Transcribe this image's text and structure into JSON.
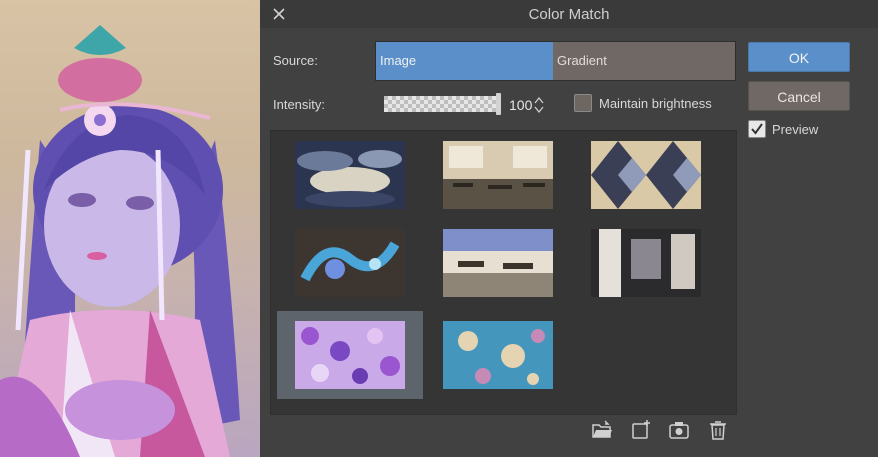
{
  "dialog": {
    "title": "Color Match",
    "source_label": "Source:",
    "source_options": [
      {
        "label": "Image",
        "selected": true
      },
      {
        "label": "Gradient",
        "selected": false
      }
    ],
    "intensity_label": "Intensity:",
    "intensity_value": "100",
    "intensity_fraction": 1.0,
    "maintain_brightness": {
      "label": "Maintain brightness",
      "checked": false
    },
    "ok_label": "OK",
    "cancel_label": "Cancel",
    "preview": {
      "label": "Preview",
      "checked": true
    },
    "thumbnails": [
      {
        "name": "thumbnail-clouds",
        "selected": false
      },
      {
        "name": "thumbnail-classroom",
        "selected": false
      },
      {
        "name": "thumbnail-kaleidoscope",
        "selected": false
      },
      {
        "name": "thumbnail-blue-splash",
        "selected": false
      },
      {
        "name": "thumbnail-cafeteria",
        "selected": false
      },
      {
        "name": "thumbnail-street",
        "selected": false
      },
      {
        "name": "thumbnail-purple-floral",
        "selected": true
      },
      {
        "name": "thumbnail-blue-floral",
        "selected": false
      }
    ],
    "toolbar_icons": [
      "open-folder-icon",
      "add-image-icon",
      "camera-icon",
      "trash-icon"
    ]
  },
  "colors": {
    "accent": "#5b8fc9",
    "panel": "#414141",
    "button": "#6f6865"
  }
}
